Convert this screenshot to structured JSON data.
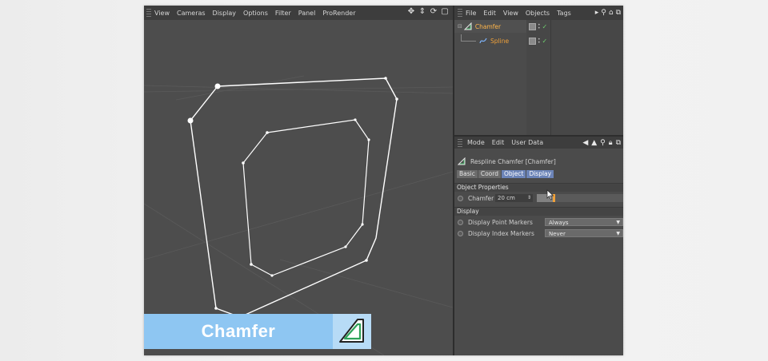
{
  "viewport": {
    "menu": [
      "View",
      "Cameras",
      "Display",
      "Options",
      "Filter",
      "Panel",
      "ProRender"
    ],
    "nav_icons": [
      "move-icon",
      "zoom-icon",
      "rotate-icon",
      "maximize-icon"
    ]
  },
  "object_manager": {
    "menu": [
      "File",
      "Edit",
      "View",
      "Objects",
      "Tags"
    ],
    "objects": [
      {
        "name": "Chamfer",
        "icon": "chamfer-icon",
        "selected": true
      },
      {
        "name": "Spline",
        "icon": "spline-icon",
        "selected": false
      }
    ]
  },
  "attributes": {
    "menu": [
      "Mode",
      "Edit",
      "User Data"
    ],
    "title": "Respline Chamfer [Chamfer]",
    "tabs": [
      {
        "label": "Basic",
        "active": false
      },
      {
        "label": "Coord",
        "active": false
      },
      {
        "label": "Object",
        "active": true
      },
      {
        "label": "Display",
        "active": true
      }
    ],
    "sections": {
      "object_properties": "Object Properties",
      "display": "Display"
    },
    "chamfer": {
      "label": "Chamfer",
      "value": "20 cm"
    },
    "display_point_markers": {
      "label": "Display Point Markers",
      "value": "Always"
    },
    "display_index_markers": {
      "label": "Display Index Markers",
      "value": "Never"
    }
  },
  "overlay": {
    "title": "Chamfer"
  },
  "colors": {
    "accent_tab": "#6c84b8",
    "object_name": "#f0a13a",
    "label_bar": "#8ec6f2",
    "spline_stroke": "#ffffff"
  }
}
